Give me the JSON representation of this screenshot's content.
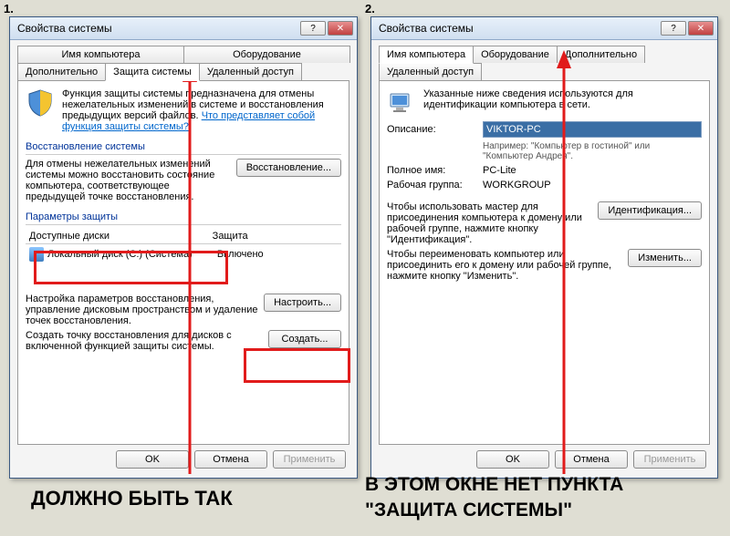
{
  "labels": {
    "num1": "1.",
    "num2": "2."
  },
  "win1": {
    "title": "Свойства системы",
    "tabs_row1": [
      "Имя компьютера",
      "Оборудование"
    ],
    "tab_active": "Защита системы",
    "tabs_row2": [
      "Дополнительно",
      "Удаленный доступ"
    ],
    "intro_text": "Функция защиты системы предназначена для отмены нежелательных изменений в системе и восстановления предыдущих версий файлов. ",
    "intro_link": "Что представляет собой функция защиты системы?",
    "sec_restore": "Восстановление системы",
    "restore_text": "Для отмены нежелательных изменений системы можно восстановить состояние компьютера, соответствующее предыдущей точке восстановления.",
    "restore_btn": "Восстановление...",
    "sec_params": "Параметры защиты",
    "col_drives": "Доступные диски",
    "col_protect": "Защита",
    "disk_name": "Локальный диск (C:) (Система)",
    "disk_state": "Включено",
    "configure_text": "Настройка параметров восстановления, управление дисковым пространством и удаление точек восстановления.",
    "configure_btn": "Настроить...",
    "create_text": "Создать точку восстановления для дисков с включенной функцией защиты системы.",
    "create_btn": "Создать...",
    "ok": "OK",
    "cancel": "Отмена",
    "apply": "Применить"
  },
  "win2": {
    "title": "Свойства системы",
    "tabs": [
      "Имя компьютера",
      "Оборудование",
      "Дополнительно",
      "Удаленный доступ"
    ],
    "intro": "Указанные ниже сведения используются для идентификации компьютера в сети.",
    "desc_label": "Описание:",
    "desc_value": "VIKTOR-PC",
    "desc_hint": "Например: \"Компьютер в гостиной\" или \"Компьютер Андрея\".",
    "fullname_label": "Полное имя:",
    "fullname_value": "PC-Lite",
    "workgroup_label": "Рабочая группа:",
    "workgroup_value": "WORKGROUP",
    "id_text": "Чтобы использовать мастер для присоединения компьютера к домену или рабочей группе, нажмите кнопку \"Идентификация\".",
    "id_btn": "Идентификация...",
    "change_text": "Чтобы переименовать компьютер или присоединить его к домену или рабочей группе, нажмите кнопку \"Изменить\".",
    "change_btn": "Изменить...",
    "ok": "OK",
    "cancel": "Отмена",
    "apply": "Применить"
  },
  "captions": {
    "left": "ДОЛЖНО БЫТЬ ТАК",
    "right1": "В ЭТОМ ОКНЕ НЕТ ПУНКТА",
    "right2": "\"ЗАЩИТА СИСТЕМЫ\""
  }
}
